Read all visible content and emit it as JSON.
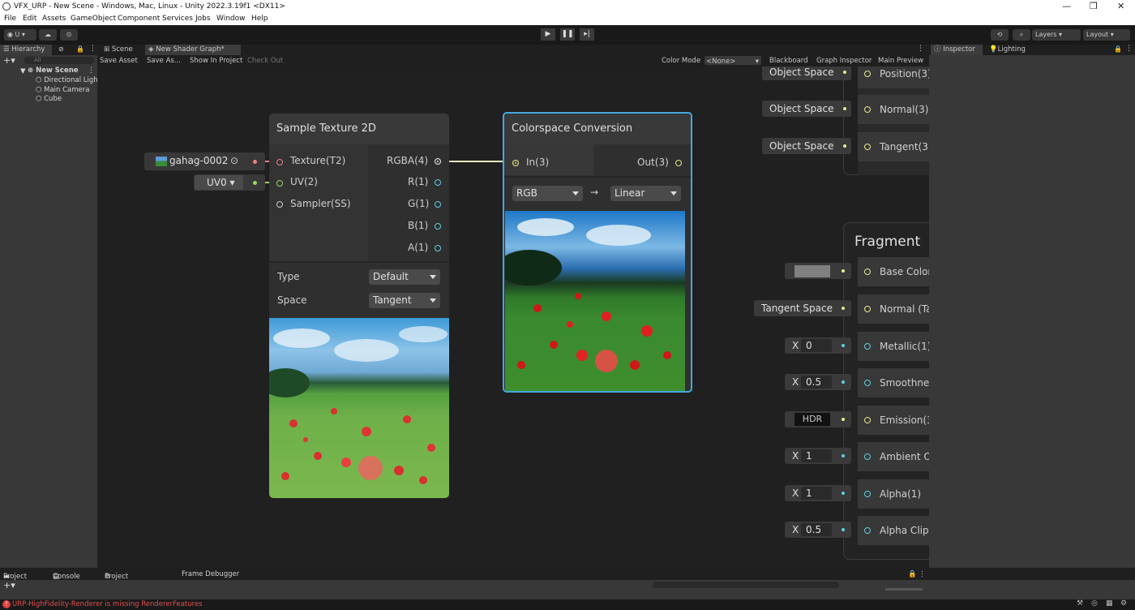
{
  "window": {
    "title": "VFX_URP - New Scene - Windows, Mac, Linux - Unity 2022.3.19f1 <DX11>"
  },
  "menu": [
    "File",
    "Edit",
    "Assets",
    "GameObject",
    "Component",
    "Services",
    "Jobs",
    "Window",
    "Help"
  ],
  "toolbar": {
    "account": "U ▾",
    "layers": "Layers",
    "layout": "Layout"
  },
  "tabs": {
    "hierarchy": "Hierarchy",
    "scene": "Scene",
    "shader_graph": "New Shader Graph*",
    "inspector": "Inspector",
    "lighting": "Lighting"
  },
  "hierarchy": {
    "search_placeholder": "All",
    "scene": "New Scene",
    "items": [
      "Directional Ligh",
      "Main Camera",
      "Cube"
    ]
  },
  "sg_toolbar": {
    "save_asset": "Save Asset",
    "save_as": "Save As...",
    "show_in_project": "Show In Project",
    "check_out": "Check Out",
    "color_mode_label": "Color Mode",
    "color_mode_value": "<None>",
    "blackboard": "Blackboard",
    "graph_inspector": "Graph Inspector",
    "main_preview": "Main Preview"
  },
  "texture_input": {
    "label": "gahag-0002"
  },
  "uv_input": {
    "label": "UV0"
  },
  "sample_node": {
    "title": "Sample Texture 2D",
    "inputs": [
      "Texture(T2)",
      "UV(2)",
      "Sampler(SS)"
    ],
    "outputs": [
      "RGBA(4)",
      "R(1)",
      "G(1)",
      "B(1)",
      "A(1)"
    ],
    "type_label": "Type",
    "type_value": "Default",
    "space_label": "Space",
    "space_value": "Tangent"
  },
  "colorspace_node": {
    "title": "Colorspace Conversion",
    "input": "In(3)",
    "output": "Out(3)",
    "from": "RGB",
    "arrow": "→",
    "to": "Linear"
  },
  "vertex_ports": [
    {
      "input": "Object Space",
      "port": "Position(3)"
    },
    {
      "input": "Object Space",
      "port": "Normal(3)"
    },
    {
      "input": "Object Space",
      "port": "Tangent(3"
    }
  ],
  "fragment": {
    "title": "Fragment",
    "base_color": "Base Color",
    "normal_input": "Tangent Space",
    "normal": "Normal (Ta",
    "metallic_x": "X",
    "metallic_value": "0",
    "metallic": "Metallic(1)",
    "smooth_x": "X",
    "smooth_value": "0.5",
    "smoothness": "Smoothnes",
    "hdr": "HDR",
    "emission": "Emission(3",
    "ao_x": "X",
    "ao_value": "1",
    "ao": "Ambient O",
    "alpha_x": "X",
    "alpha_value": "1",
    "alpha": "Alpha(1)",
    "clip_x": "X",
    "clip_value": "0.5",
    "clip": "Alpha Clip"
  },
  "bottom_tabs": {
    "project": "Project",
    "console": "Console",
    "project_settings": "Project Settings",
    "frame_debugger": "Frame Debugger"
  },
  "status": {
    "message": "URP-HighFidelity-Renderer is missing RendererFeatures"
  }
}
